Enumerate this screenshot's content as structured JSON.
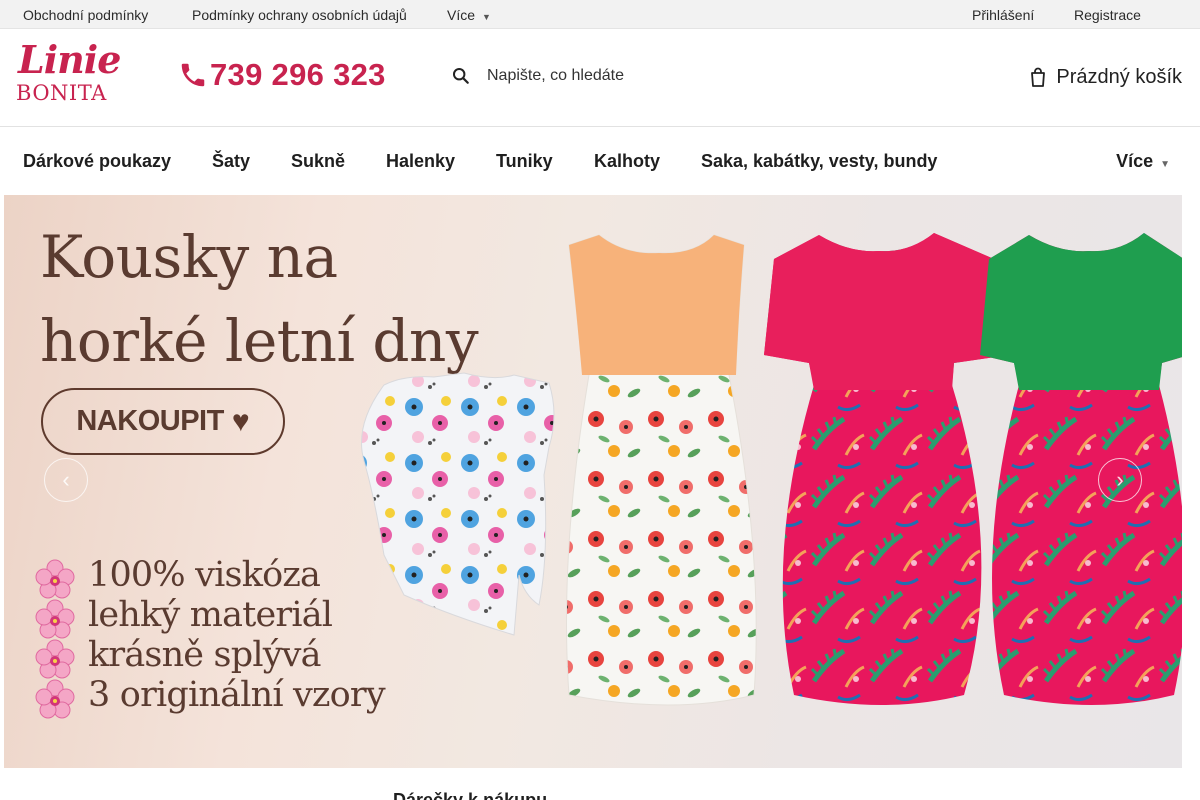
{
  "topbar": {
    "links": [
      "Obchodní podmínky",
      "Podmínky ochrany osobních údajů"
    ],
    "more_label": "Více",
    "login": "Přihlášení",
    "register": "Registrace"
  },
  "header": {
    "logo_line1": "Linie",
    "logo_line2": "BONITA",
    "phone": "739 296 323",
    "search_placeholder": "Napište, co hledáte",
    "cart_label": "Prázdný košík"
  },
  "nav": {
    "items": [
      "Dárkové poukazy",
      "Šaty",
      "Sukně",
      "Halenky",
      "Tuniky",
      "Kalhoty",
      "Saka, kabátky, vesty, bundy"
    ],
    "more_label": "Více"
  },
  "hero": {
    "headline": "Kousky na\nhorké letní dny",
    "cta_label": "NAKOUPIT",
    "features": [
      "100% viskóza",
      "lehký materiál",
      "krásně splývá",
      "3 originální vzory"
    ],
    "prev_icon": "chevron-left-icon",
    "next_icon": "chevron-right-icon"
  },
  "section": {
    "title": "Dárečky k nákupu"
  },
  "colors": {
    "brand": "#c8234f",
    "hero_text": "#5a3b30",
    "topbar_bg": "#f2f2f2"
  }
}
